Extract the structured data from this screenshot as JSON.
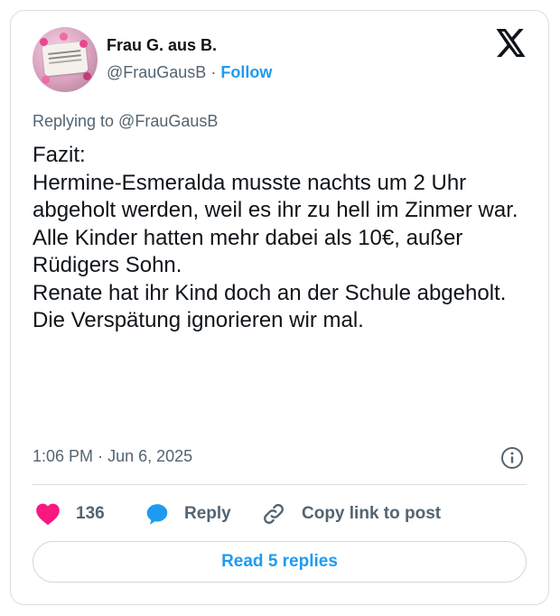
{
  "tweet": {
    "author_name": "Frau G. aus B.",
    "author_handle": "@FrauGausB",
    "separator": "·",
    "follow_label": "Follow",
    "replying_to": "Replying to @FrauGausB",
    "text": "Fazit:\nHermine-Esmeralda musste nachts um 2 Uhr abgeholt werden, weil es ihr zu hell im Zinmer war.\nAlle Kinder hatten mehr dabei als 10€, außer Rüdigers Sohn.\nRenate hat ihr Kind doch an der Schule abgeholt. Die Verspätung ignorieren wir mal.",
    "time": "1:06 PM",
    "date": "Jun 6, 2025",
    "likes": "136",
    "reply_label": "Reply",
    "copy_label": "Copy link to post",
    "read_replies_label": "Read 5 replies"
  },
  "icons": {
    "logo": "x-logo-icon",
    "info": "info-icon",
    "like": "heart-icon",
    "reply": "speech-bubble-icon",
    "copy": "link-icon"
  },
  "colors": {
    "heart": "#f91880",
    "reply_bubble": "#1d9bf0",
    "accent": "#1d9bf0",
    "secondary_text": "#536471"
  }
}
